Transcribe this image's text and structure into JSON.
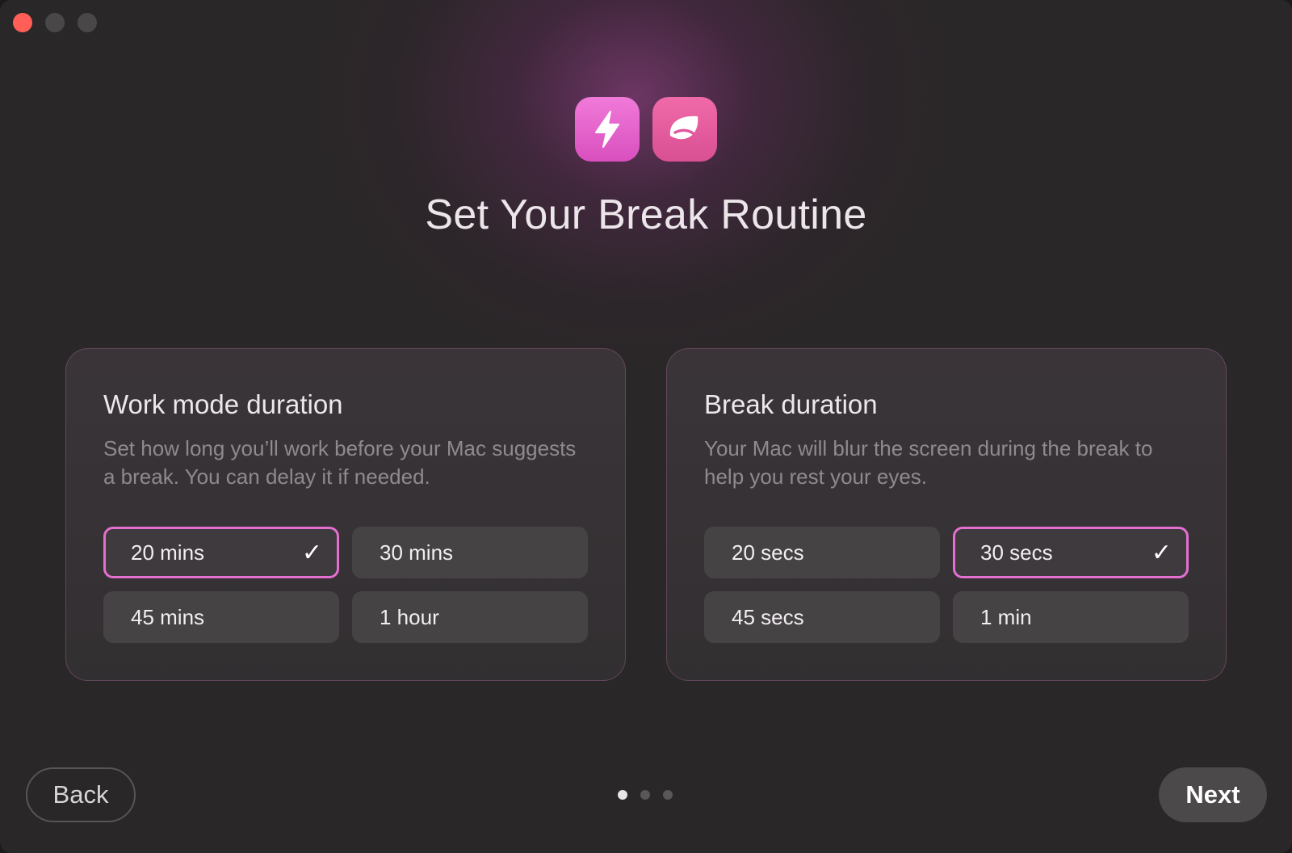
{
  "window": {
    "controls": [
      "close",
      "minimize",
      "maximize"
    ]
  },
  "header": {
    "icons": [
      "bolt-icon",
      "leaf-icon"
    ],
    "title": "Set Your Break Routine"
  },
  "work_card": {
    "title": "Work mode duration",
    "description": "Set how long you’ll work before your Mac suggests a break. You can delay it if needed.",
    "options": [
      {
        "label": "20 mins",
        "selected": true
      },
      {
        "label": "30 mins",
        "selected": false
      },
      {
        "label": "45 mins",
        "selected": false
      },
      {
        "label": "1 hour",
        "selected": false
      }
    ]
  },
  "break_card": {
    "title": "Break duration",
    "description": "Your Mac will blur the screen during the break to help you rest your eyes.",
    "options": [
      {
        "label": "20 secs",
        "selected": false
      },
      {
        "label": "30 secs",
        "selected": true
      },
      {
        "label": "45 secs",
        "selected": false
      },
      {
        "label": "1 min",
        "selected": false
      }
    ]
  },
  "footer": {
    "back_label": "Back",
    "next_label": "Next",
    "page_indicator": {
      "total": 3,
      "current": 1
    }
  },
  "colors": {
    "accent": "#e46fd0",
    "close": "#ff5f57",
    "background": "#2a2728"
  }
}
